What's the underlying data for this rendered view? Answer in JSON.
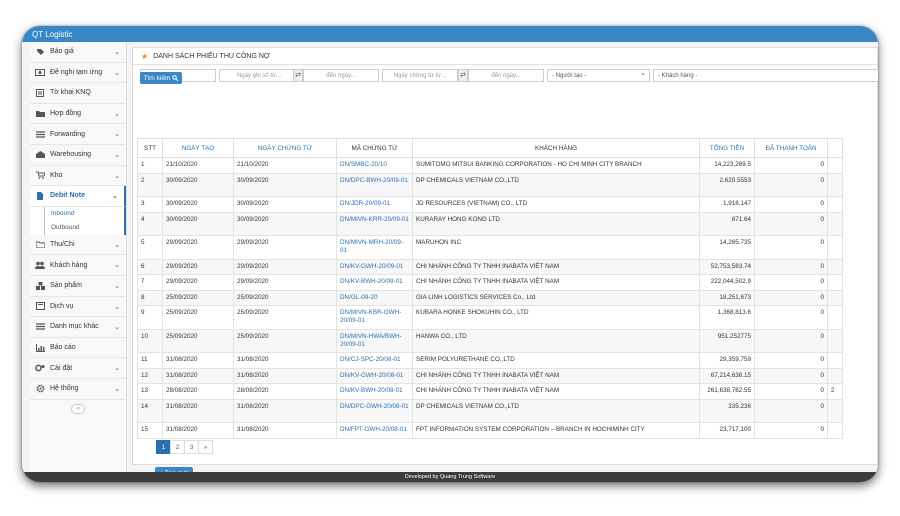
{
  "app_title": "QT Logistic",
  "sidebar": {
    "items": [
      {
        "label": "Báo giá",
        "icon": "price-tag-icon"
      },
      {
        "label": "Đề nghị tạm ứng",
        "icon": "money-icon"
      },
      {
        "label": "Tờ khai KNQ",
        "icon": "document-icon"
      },
      {
        "label": "Hợp đồng",
        "icon": "folder-icon"
      },
      {
        "label": "Forwarding",
        "icon": "list-icon"
      },
      {
        "label": "Warehousing",
        "icon": "warehouse-icon"
      },
      {
        "label": "Kho",
        "icon": "cart-icon"
      },
      {
        "label": "Debit Note",
        "icon": "file-icon"
      },
      {
        "label": "Thu/Chi",
        "icon": "folder-open-icon"
      },
      {
        "label": "Khách hàng",
        "icon": "users-icon"
      },
      {
        "label": "Sản phẩm",
        "icon": "boxes-icon"
      },
      {
        "label": "Dịch vụ",
        "icon": "service-icon"
      },
      {
        "label": "Danh mục khác",
        "icon": "list-icon"
      },
      {
        "label": "Báo cáo",
        "icon": "chart-icon"
      },
      {
        "label": "Cài đặt",
        "icon": "gears-icon"
      },
      {
        "label": "Hệ thống",
        "icon": "gear-icon"
      }
    ],
    "sub_items": [
      {
        "label": "Inbound"
      },
      {
        "label": "Outbound"
      }
    ],
    "collapse_glyph": "«"
  },
  "panel": {
    "title": "DANH SÁCH PHIẾU THU CÔNG NỢ",
    "filters": {
      "doc_no_placeholder": "Mã chứng từ...",
      "record_from_placeholder": "Ngày ghi sổ từ...",
      "to_date_placeholder": "đến ngày...",
      "doc_date_from_placeholder": "Ngày chứng từ từ...",
      "to_date2_placeholder": "đến ngày...",
      "creator_select": "- Người tạo -",
      "customer_select": "- Khách hàng -"
    },
    "search_label": "Tìm kiếm"
  },
  "table": {
    "headers": [
      "STT",
      "NGÀY TẠO",
      "NGÀY CHỨNG TỪ",
      "MÃ CHỨNG TỪ",
      "KHÁCH HÀNG",
      "TỔNG TIỀN",
      "ĐÃ THANH TOÁN"
    ],
    "rows": [
      {
        "stt": "1",
        "created": "21/10/2020",
        "doc_date": "21/10/2020",
        "doc_no": "DN/SMBC-20/10",
        "customer": "SUMITOMO MITSUI BANKING CORPORATION - HO CHI MINH CITY BRANCH",
        "total": "14,223,269.5",
        "paid": "0",
        "extra": ""
      },
      {
        "stt": "2",
        "created": "30/09/2020",
        "doc_date": "30/09/2020",
        "doc_no": "DN/DPC-BWH-20/09-01",
        "customer": "DP CHEMICALS VIETNAM CO.,LTD",
        "total": "2,620.5553",
        "paid": "0",
        "extra": ""
      },
      {
        "stt": "3",
        "created": "30/09/2020",
        "doc_date": "30/09/2020",
        "doc_no": "DN/JDR-20/09-01",
        "customer": "JD RESOURCES (VIETNAM) CO., LTD",
        "total": "1,918.147",
        "paid": "0",
        "extra": ""
      },
      {
        "stt": "4",
        "created": "30/09/2020",
        "doc_date": "30/09/2020",
        "doc_no": "DN/MIVN-KRR-20/09-01",
        "customer": "KURARAY HONG KONG LTD",
        "total": "871.64",
        "paid": "0",
        "extra": ""
      },
      {
        "stt": "5",
        "created": "29/09/2020",
        "doc_date": "29/09/2020",
        "doc_no": "DN/MIVN-MRH-20/09-01",
        "customer": "MARUHON INC",
        "total": "14,265.735",
        "paid": "0",
        "extra": ""
      },
      {
        "stt": "6",
        "created": "29/09/2020",
        "doc_date": "29/09/2020",
        "doc_no": "DN/KV-GWH-20/09-01",
        "customer": "CHI NHÁNH CÔNG TY TNHH INABATA VIỆT NAM",
        "total": "52,753,583.74",
        "paid": "0",
        "extra": ""
      },
      {
        "stt": "7",
        "created": "29/09/2020",
        "doc_date": "29/09/2020",
        "doc_no": "DN/KV-BWH-20/09-01",
        "customer": "CHI NHÁNH CÔNG TY TNHH INABATA VIỆT NAM",
        "total": "222,044,502.9",
        "paid": "0",
        "extra": ""
      },
      {
        "stt": "8",
        "created": "25/09/2020",
        "doc_date": "25/09/2020",
        "doc_no": "DN/GL-09-20",
        "customer": "GIA LINH LOGISTICS SERVICES Co., Ltd",
        "total": "18,251,673",
        "paid": "0",
        "extra": ""
      },
      {
        "stt": "9",
        "created": "25/09/2020",
        "doc_date": "25/09/2020",
        "doc_no": "DN/MIVN-KBR-GWH-20/09-01",
        "customer": "KUBARA HONKE SHOKUHIN CO., LTD",
        "total": "1,368,813.6",
        "paid": "0",
        "extra": ""
      },
      {
        "stt": "10",
        "created": "25/09/2020",
        "doc_date": "25/09/2020",
        "doc_no": "DN/MIVN-HWA/BWH-20/09-01",
        "customer": "HANWA CO., LTD",
        "total": "951.252775",
        "paid": "0",
        "extra": ""
      },
      {
        "stt": "11",
        "created": "31/08/2020",
        "doc_date": "31/08/2020",
        "doc_no": "DN/CJ-SPC-20/08-01",
        "customer": "SERIM POLYURETHANE CO.,LTD",
        "total": "29,359,759",
        "paid": "0",
        "extra": ""
      },
      {
        "stt": "12",
        "created": "31/08/2020",
        "doc_date": "31/08/2020",
        "doc_no": "DN/KV-GWH-20/08-01",
        "customer": "CHI NHÁNH CÔNG TY TNHH INABATA VIỆT NAM",
        "total": "67,214,638.15",
        "paid": "0",
        "extra": ""
      },
      {
        "stt": "13",
        "created": "28/08/2020",
        "doc_date": "28/08/2020",
        "doc_no": "DN/KV-BWH-20/08-01",
        "customer": "CHI NHÁNH CÔNG TY TNHH INABATA VIỆT NAM",
        "total": "261,638,762.55",
        "paid": "0",
        "extra": "2"
      },
      {
        "stt": "14",
        "created": "31/08/2020",
        "doc_date": "31/08/2020",
        "doc_no": "DN/DPC-GWH-20/08-01",
        "customer": "DP CHEMICALS VIETNAM CO.,LTD",
        "total": "335.236",
        "paid": "0",
        "extra": ""
      },
      {
        "stt": "15",
        "created": "31/08/2020",
        "doc_date": "31/08/2020",
        "doc_no": "DN/FPT-GWH-20/08-01",
        "customer": "FPT INFORMATION SYSTEM CORPORATION – BRANCH IN HOCHIMINH CITY",
        "total": "23,717,100",
        "paid": "0",
        "extra": ""
      }
    ]
  },
  "pagination": {
    "pages": [
      "1",
      "2",
      "3"
    ],
    "next": "»",
    "current": "1"
  },
  "add_button_label": "Tạo mới",
  "footer": "Developed by Quang Trung Software",
  "colors": {
    "accent": "#3a87c8",
    "link": "#2a6fb0",
    "star": "#f08a24",
    "footer": "#3c3c3c"
  }
}
